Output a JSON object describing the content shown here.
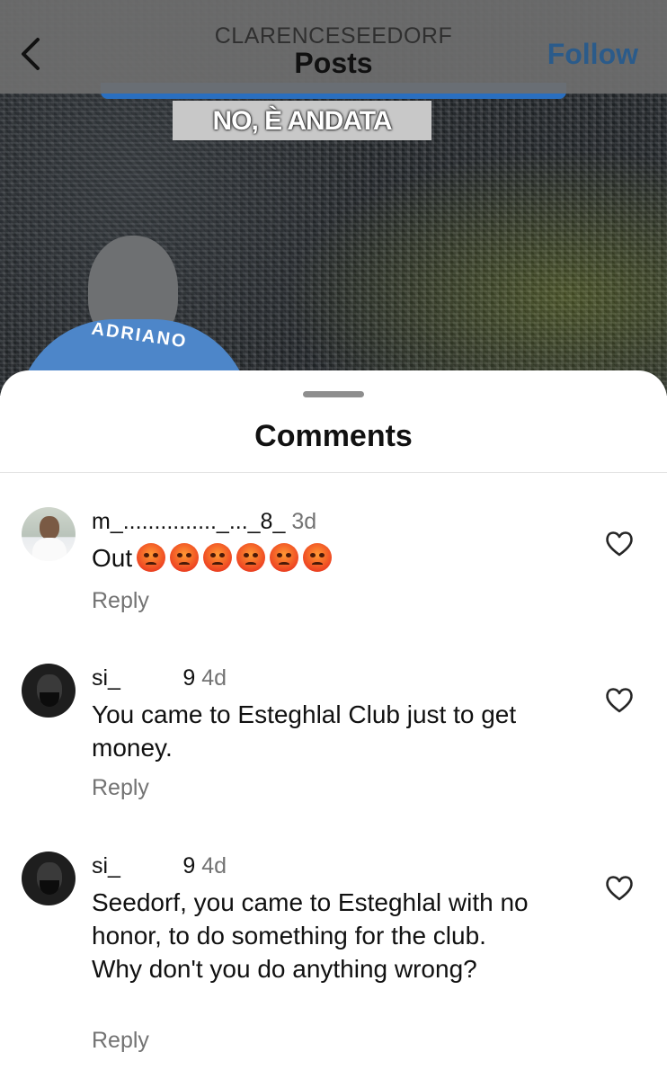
{
  "post": {
    "caption_text": "NO, È ANDATA",
    "shirt_name": "ADRIANO"
  },
  "header": {
    "account_name": "CLARENCESEEDORF",
    "title": "Posts",
    "follow_label": "Follow",
    "back_icon": "chevron-left-icon",
    "accent_color": "#2b5b8a"
  },
  "sheet": {
    "title": "Comments"
  },
  "comments": [
    {
      "username": "m_..............._..._8_",
      "time": "3d",
      "text": "Out",
      "emoji_count": 6,
      "emoji_icon": "angry-face-emoji",
      "reply_label": "Reply"
    },
    {
      "username": "si_          9",
      "time": "4d",
      "text": "You came to Esteghlal Club just to get money.",
      "reply_label": "Reply"
    },
    {
      "username": "si_          9",
      "time": "4d",
      "text": "Seedorf, you came to Esteghlal with no honor, to do something for the club. Why don't you do anything wrong?",
      "reply_label": "Reply"
    }
  ]
}
